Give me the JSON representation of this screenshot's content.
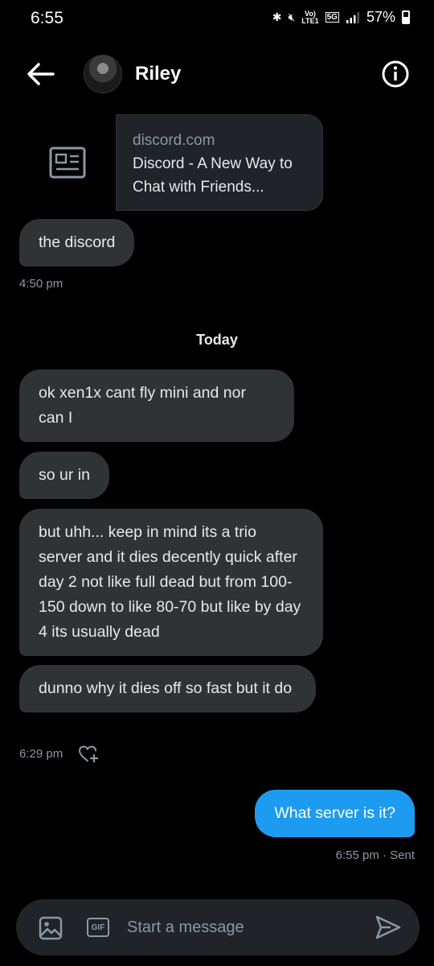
{
  "status_bar": {
    "time": "6:55",
    "network": "LTE1",
    "net_top": "Vo)",
    "five_g": "5G",
    "battery": "57%"
  },
  "header": {
    "contact_name": "Riley"
  },
  "link_card": {
    "domain": "discord.com",
    "title": "Discord - A New Way to Chat with Friends..."
  },
  "messages_earlier": {
    "bubble": "the discord",
    "time": "4:50 pm"
  },
  "day_separator": "Today",
  "messages_today": [
    {
      "text": "ok xen1x cant fly mini and nor can I"
    },
    {
      "text": "so ur in"
    },
    {
      "text": "but uhh... keep in mind its a trio server and it dies decently quick after day 2 not like full dead but from 100-150 down to like 80-70 but like by day 4 its usually dead"
    },
    {
      "text": "dunno why it dies off so fast but it do"
    }
  ],
  "incoming_time": "6:29 pm",
  "outgoing": {
    "text": "What server is it?",
    "meta": "6:55 pm · Sent"
  },
  "composer": {
    "placeholder": "Start a message",
    "gif_label": "GIF"
  },
  "colors": {
    "accent": "#1d9bf0",
    "bubble_in": "#2f3336",
    "background": "#000000",
    "muted_text": "#8b98a5"
  }
}
